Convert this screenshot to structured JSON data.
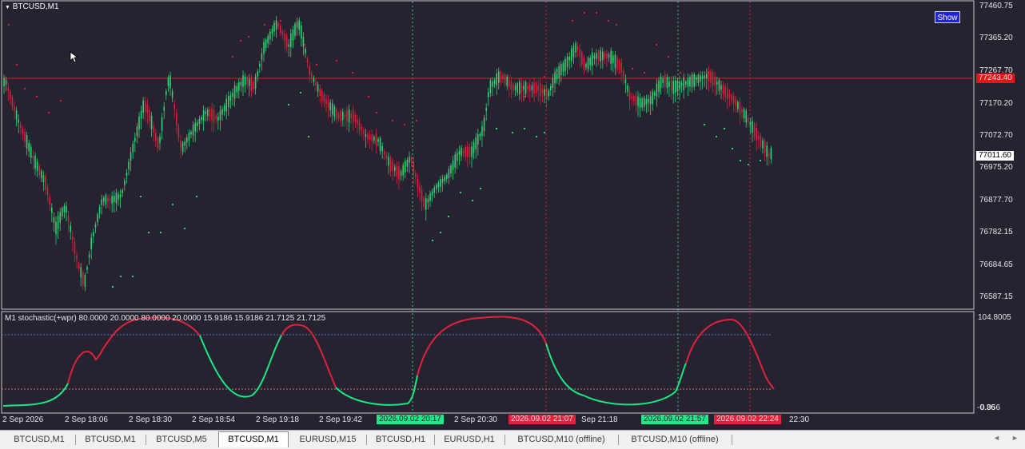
{
  "window": {
    "symbol_title": "BTCUSD,M1",
    "show_button": "Show"
  },
  "price_axis": {
    "labels": [
      "77460.75",
      "77365.20",
      "77267.70",
      "77170.20",
      "77072.70",
      "76975.20",
      "76877.70",
      "76782.15",
      "76684.65",
      "76587.15"
    ],
    "current_price": "77011.60",
    "red_line_price": "77243.40"
  },
  "indicator": {
    "title": "M1 stochastic(+wpr) 80.0000 20.0000 80.0000 20.0000 15.9186 15.9186 21.7125 21.7125",
    "axis_top": "104.8005",
    "axis_bottom": "0.056",
    "axis_bottom_overlap": "-0.36"
  },
  "time_axis": {
    "labels": [
      "2 Sep 2026",
      "2 Sep 18:06",
      "2 Sep 18:30",
      "2 Sep 18:54",
      "2 Sep 19:18",
      "2 Sep 19:42",
      "2 Sep 20:30",
      "Sep 21:18",
      "22:30"
    ],
    "green_tags": [
      "2026.09.02 20:17",
      "2026.09.02 21:57"
    ],
    "red_tags": [
      "2026.09.02 21:07",
      "2026.09.02 22:24"
    ]
  },
  "colors": {
    "background": "#262230",
    "bull": "#2fd276",
    "bear": "#d8203c",
    "stoch_up": "#19e887",
    "stoch_down": "#e0223f",
    "level_80": "#2a8ec0",
    "level_20": "#d68a1a",
    "red_line": "#d81e1e"
  },
  "tabs": [
    {
      "label": "BTCUSD,M1",
      "active": false
    },
    {
      "label": "BTCUSD,M1",
      "active": false
    },
    {
      "label": "BTCUSD,M5",
      "active": false
    },
    {
      "label": "BTCUSD,M1",
      "active": true
    },
    {
      "label": "EURUSD,M15",
      "active": false
    },
    {
      "label": "BTCUSD,H1",
      "active": false
    },
    {
      "label": "EURUSD,H1",
      "active": false
    },
    {
      "label": "BTCUSD,M10 (offline)",
      "active": false
    },
    {
      "label": "BTCUSD,M10 (offline)",
      "active": false
    }
  ],
  "scroll": {
    "left_icon": "chevron-left-icon",
    "right_icon": "chevron-right-icon"
  }
}
